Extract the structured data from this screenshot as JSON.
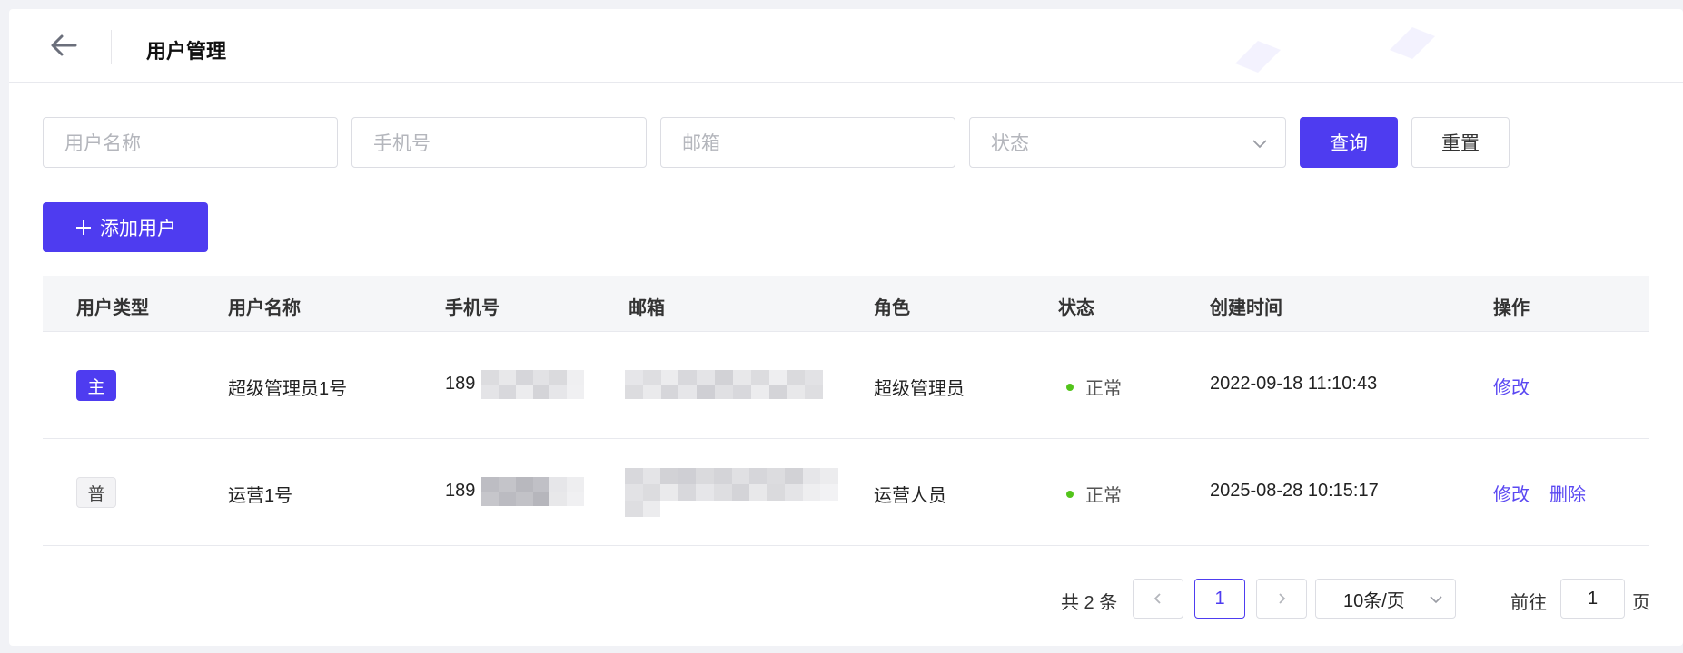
{
  "header": {
    "title": "用户管理",
    "back_icon": "arrow-left-icon"
  },
  "filters": {
    "username_placeholder": "用户名称",
    "phone_placeholder": "手机号",
    "email_placeholder": "邮箱",
    "status_placeholder": "状态",
    "query_label": "查询",
    "reset_label": "重置"
  },
  "toolbar": {
    "add_label": "添加用户",
    "add_icon": "plus-icon"
  },
  "table": {
    "columns": [
      "用户类型",
      "用户名称",
      "手机号",
      "邮箱",
      "角色",
      "状态",
      "创建时间",
      "操作"
    ],
    "rows": [
      {
        "type": "主",
        "username": "超级管理员1号",
        "phone_prefix": "189",
        "role": "超级管理员",
        "status": "正常",
        "created": "2022-09-18 11:10:43",
        "actions": [
          "修改"
        ]
      },
      {
        "type": "普",
        "username": "运营1号",
        "phone_prefix": "189",
        "role": "运营人员",
        "status": "正常",
        "created": "2025-08-28 10:15:17",
        "actions": [
          "修改",
          "删除"
        ]
      }
    ]
  },
  "pagination": {
    "total_text": "共 2 条",
    "current_page": "1",
    "page_size": "10条/页",
    "goto_label": "前往",
    "goto_value": "1",
    "page_suffix": "页"
  },
  "colors": {
    "primary": "#4e3cf0",
    "status_ok": "#52c41a",
    "link": "#5a48f2"
  }
}
